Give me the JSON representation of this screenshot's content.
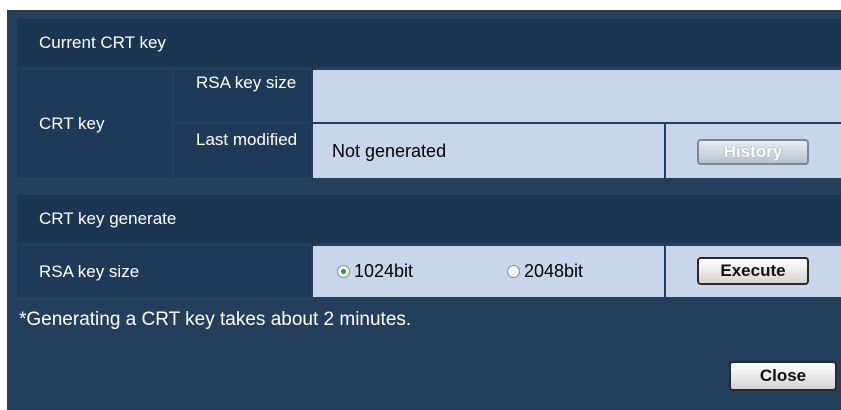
{
  "current_section": {
    "title": "Current CRT key",
    "row_label": "CRT key",
    "rsa_key_size_label": "RSA key size",
    "rsa_key_size_value": "",
    "last_modified_label": "Last modified",
    "last_modified_value": "Not generated",
    "history_button": "History"
  },
  "generate_section": {
    "title": "CRT key generate",
    "rsa_key_size_label": "RSA key size",
    "options": [
      "1024bit",
      "2048bit"
    ],
    "selected": "1024bit",
    "execute_button": "Execute"
  },
  "note": "*Generating a CRT key takes about 2 minutes.",
  "close_button": "Close"
}
